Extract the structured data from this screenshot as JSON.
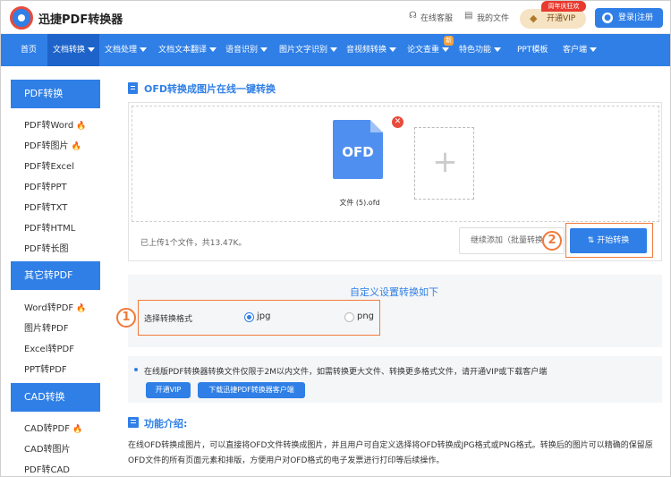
{
  "header": {
    "brand": "迅捷PDF转换器",
    "support": "在线客服",
    "myfiles": "我的文件",
    "vip_badge": "周年庆狂欢",
    "vip_label": "开通VIP",
    "login": "登录|注册"
  },
  "nav": {
    "items": [
      {
        "label": "首页"
      },
      {
        "label": "文档转换"
      },
      {
        "label": "文档处理"
      },
      {
        "label": "文档文本翻译"
      },
      {
        "label": "语音识别"
      },
      {
        "label": "图片文字识别"
      },
      {
        "label": "音视频转换"
      },
      {
        "label": "论文查重"
      },
      {
        "label": "特色功能"
      },
      {
        "label": "PPT模板"
      },
      {
        "label": "客户端"
      }
    ],
    "new_badge": "新"
  },
  "sidebar": {
    "sections": [
      {
        "title": "PDF转换",
        "items": [
          "PDF转Word",
          "PDF转图片",
          "PDF转Excel",
          "PDF转PPT",
          "PDF转TXT",
          "PDF转HTML",
          "PDF转长图"
        ]
      },
      {
        "title": "其它转PDF",
        "items": [
          "Word转PDF",
          "图片转PDF",
          "Excel转PDF",
          "PPT转PDF"
        ]
      },
      {
        "title": "CAD转换",
        "items": [
          "CAD转PDF",
          "CAD转图片",
          "PDF转CAD"
        ]
      }
    ]
  },
  "main": {
    "title": "OFD转换成图片在线一键转换",
    "file_icon_text": "OFD",
    "file_name": "文件 (5).ofd",
    "status": "已上传1个文件，共13.47K。",
    "continue_label": "继续添加（批量转换）",
    "start_label": "开始转换",
    "marker1": "1",
    "marker2": "2"
  },
  "settings": {
    "title": "自定义设置转换如下",
    "format_label": "选择转换格式",
    "options": [
      "jpg",
      "png"
    ],
    "selected": "jpg"
  },
  "notice": {
    "text": "在线版PDF转换器转换文件仅限于2M以内文件，如需转换更大文件、转换更多格式文件，请开通VIP或下载客户端",
    "vip_btn": "开通VIP",
    "download_btn": "下载迅捷PDF转换器客户端"
  },
  "intro": {
    "title": "功能介绍:",
    "text": "在线OFD转换成图片，可以直接将OFD文件转换成图片，并且用户可自定义选择将OFD转换成JPG格式或PNG格式。转换后的图片可以精确的保留原OFD文件的所有页面元素和排版，方便用户对OFD格式的电子发票进行打印等后续操作。"
  },
  "colors": {
    "accent": "#2f7fe6",
    "highlight": "#f07a3a",
    "danger": "#e84b3c"
  }
}
